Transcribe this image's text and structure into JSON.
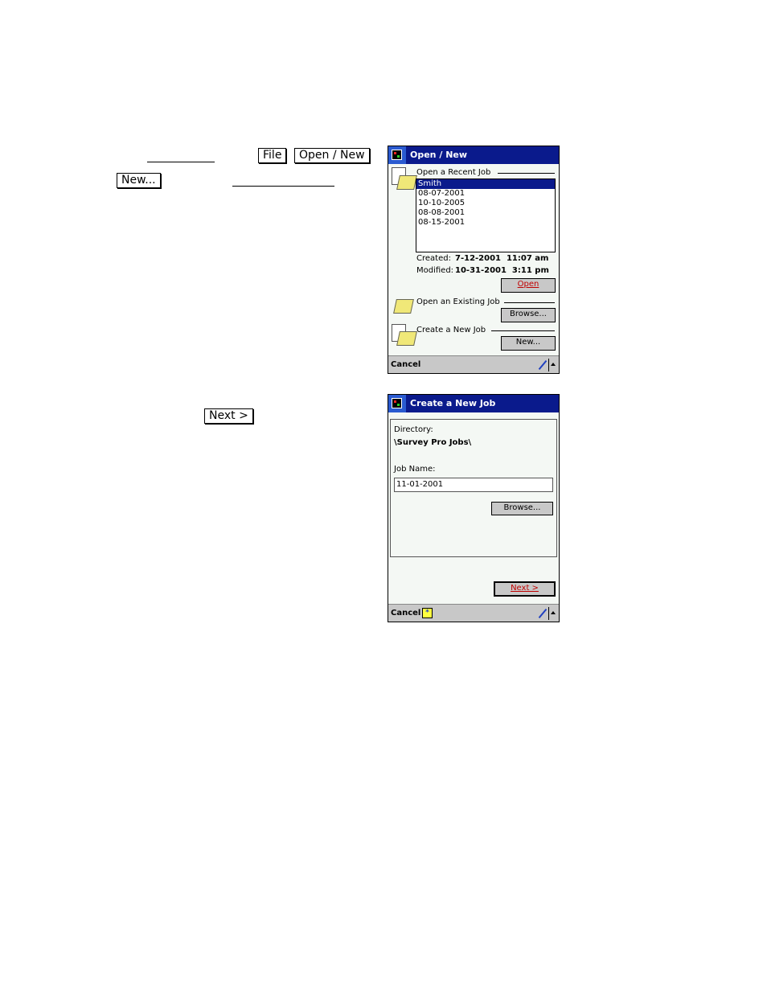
{
  "instructions": {
    "step1_keys": [
      "File",
      "Open / New"
    ],
    "step2_key": "New...",
    "step3_key": "Next >"
  },
  "screen1": {
    "title": "Open / New",
    "recent_group_label": "Open a Recent Job",
    "recent_jobs": [
      "Smith",
      "08-07-2001",
      "10-10-2005",
      "08-08-2001",
      "08-15-2001"
    ],
    "selected_index": 0,
    "created_label": "Created:",
    "created_value": "7-12-2001  11:07 am",
    "modified_label": "Modified:",
    "modified_value": "10-31-2001  3:11 pm",
    "open_button": "Open",
    "existing_group_label": "Open an Existing Job",
    "browse_button": "Browse...",
    "new_group_label": "Create a New Job",
    "new_button": "New...",
    "cancel_label": "Cancel"
  },
  "screen2": {
    "title": "Create a New Job",
    "directory_label": "Directory:",
    "directory_value": "\\Survey Pro Jobs\\",
    "job_name_label": "Job Name:",
    "job_name_value": "11-01-2001",
    "browse_button": "Browse...",
    "next_button": "Next >",
    "cancel_label": "Cancel"
  }
}
